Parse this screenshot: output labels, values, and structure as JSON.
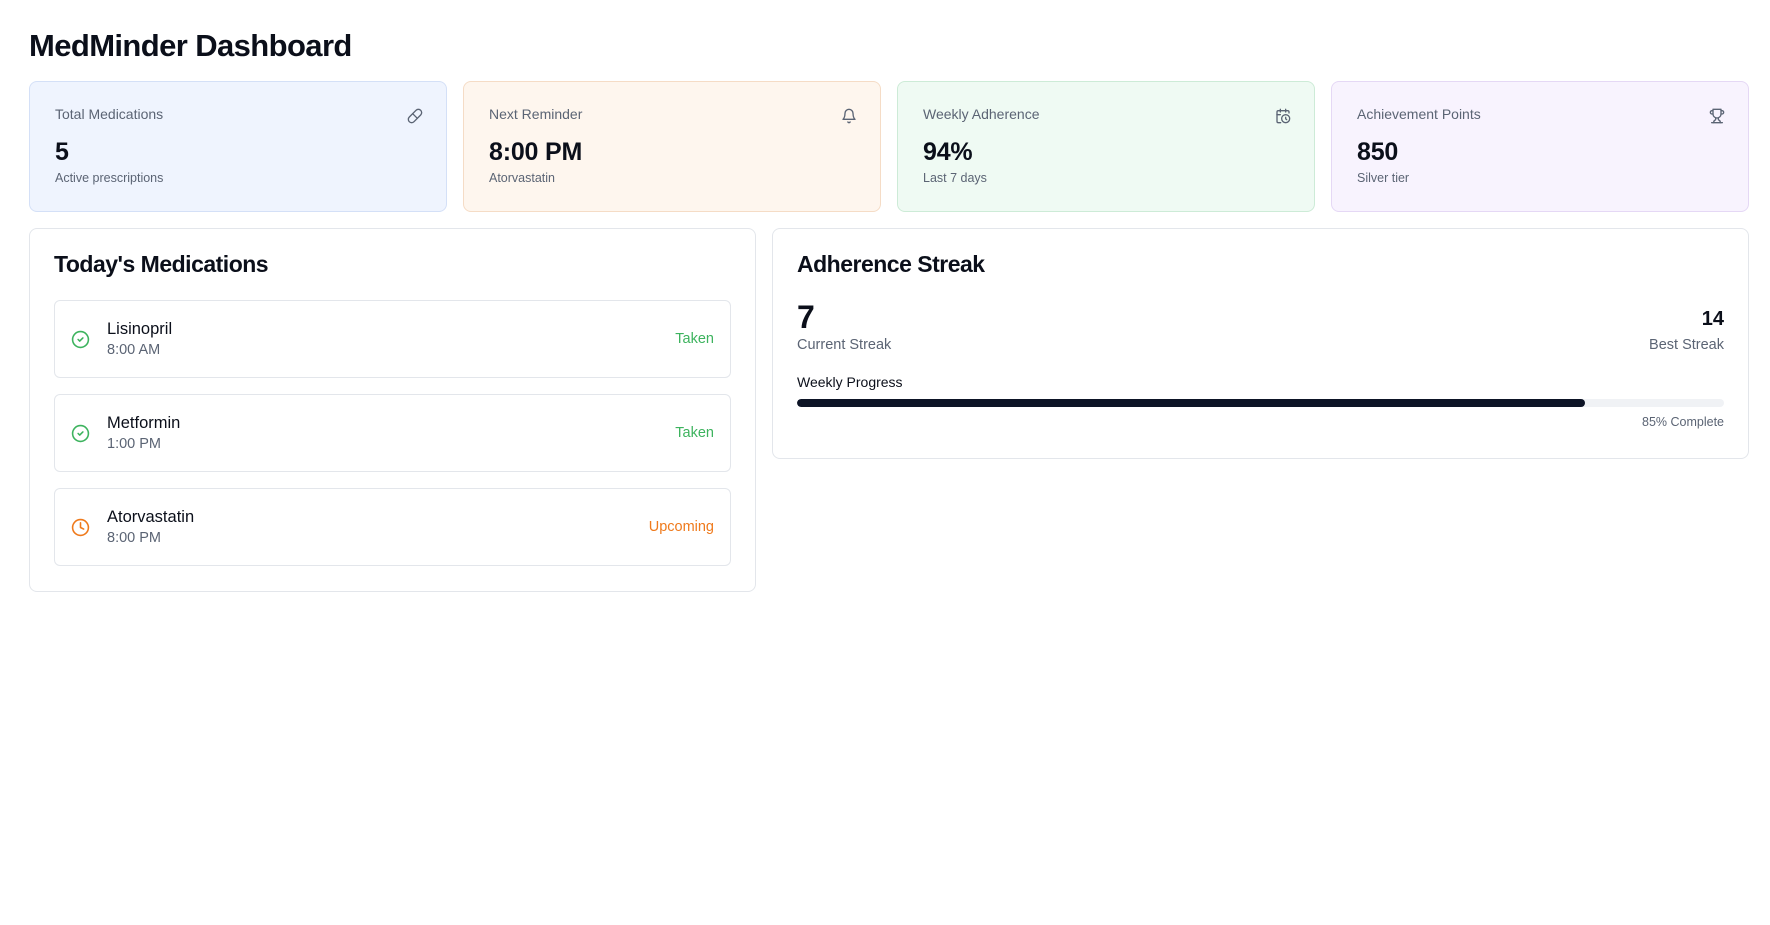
{
  "page": {
    "title": "MedMinder Dashboard"
  },
  "stats": [
    {
      "label": "Total Medications",
      "value": "5",
      "sub": "Active prescriptions",
      "icon": "pill-icon",
      "tone": "blue"
    },
    {
      "label": "Next Reminder",
      "value": "8:00 PM",
      "sub": "Atorvastatin",
      "icon": "bell-icon",
      "tone": "orange"
    },
    {
      "label": "Weekly Adherence",
      "value": "94%",
      "sub": "Last 7 days",
      "icon": "calendar-clock-icon",
      "tone": "green"
    },
    {
      "label": "Achievement Points",
      "value": "850",
      "sub": "Silver tier",
      "icon": "trophy-icon",
      "tone": "purple"
    }
  ],
  "medications": {
    "title": "Today's Medications",
    "items": [
      {
        "name": "Lisinopril",
        "time": "8:00 AM",
        "status": "Taken",
        "icon": "check-circle-icon"
      },
      {
        "name": "Metformin",
        "time": "1:00 PM",
        "status": "Taken",
        "icon": "check-circle-icon"
      },
      {
        "name": "Atorvastatin",
        "time": "8:00 PM",
        "status": "Upcoming",
        "icon": "clock-icon"
      }
    ]
  },
  "streak": {
    "title": "Adherence Streak",
    "current_value": "7",
    "current_label": "Current Streak",
    "best_value": "14",
    "best_label": "Best Streak",
    "progress_label": "Weekly Progress",
    "progress_percent": 85,
    "progress_text": "85% Complete"
  },
  "colors": {
    "taken": "#3db35e",
    "upcoming": "#ef7a1c",
    "progress_fill": "#0d1426"
  }
}
